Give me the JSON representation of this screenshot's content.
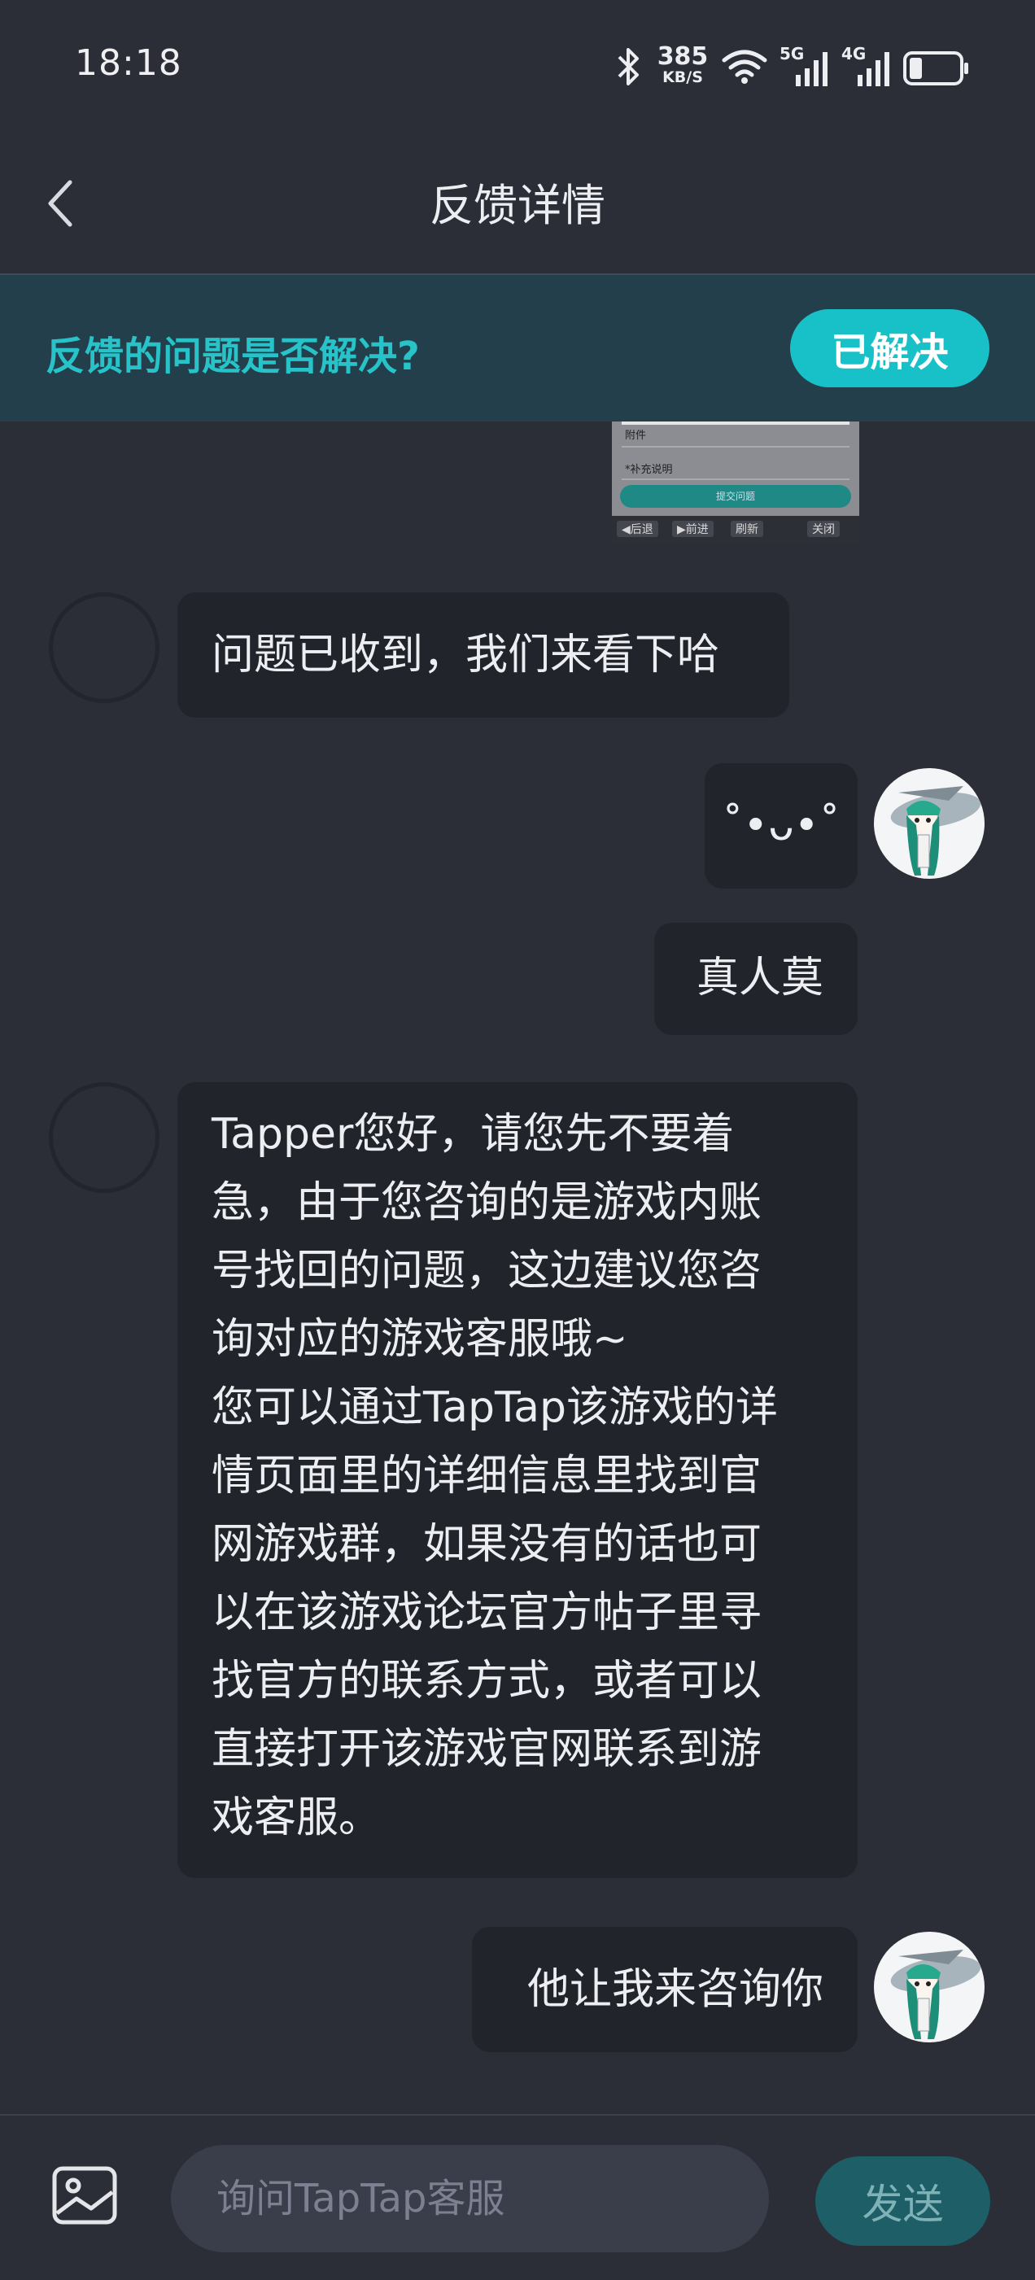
{
  "status_bar": {
    "time": "18:18",
    "net_speed_value": "385",
    "net_speed_unit": "KB/S",
    "sig1_label": "5G",
    "sig2_label": "4G",
    "battery_level": 0.25,
    "icons": [
      "bluetooth-icon",
      "wifi-icon",
      "signal-5g-icon",
      "signal-4g-icon",
      "battery-icon"
    ]
  },
  "header": {
    "title": "反馈详情",
    "back_icon": "chevron-left-icon"
  },
  "feedback_bar": {
    "question": "反馈的问题是否解决?",
    "resolved_label": "已解决"
  },
  "thumbnail": {
    "field1": "附件",
    "field2": "*补充说明",
    "submit": "提交问题",
    "nav": [
      "◀后退",
      "▶前进",
      "刷新",
      "关闭"
    ]
  },
  "messages": [
    {
      "side": "left",
      "text": "问题已收到，我们来看下哈"
    },
    {
      "side": "right",
      "text": "˚•ᴗ•˚"
    },
    {
      "side": "right",
      "text": "真人莫"
    },
    {
      "side": "left",
      "lines": [
        "Tapper您好，请您先不要着",
        "急，由于您咨询的是游戏内账",
        "号找回的问题，这边建议您咨",
        "询对应的游戏客服哦~",
        "您可以通过TapTap该游戏的详",
        "情页面里的详细信息里找到官",
        "网游戏群，如果没有的话也可",
        "以在该游戏论坛官方帖子里寻",
        "找官方的联系方式，或者可以",
        "直接打开该游戏官网联系到游",
        "戏客服。"
      ]
    },
    {
      "side": "right",
      "text": "他让我来咨询你"
    }
  ],
  "bottom_bar": {
    "image_icon": "image-icon",
    "input_placeholder": "询问TapTap客服",
    "input_value": "",
    "send_label": "发送"
  },
  "colors": {
    "background": "#2b2d37",
    "bubble": "#22242c",
    "accent": "#17c1c7",
    "feedback_bar": "#223f4b",
    "send_button": "#1e5e66"
  }
}
